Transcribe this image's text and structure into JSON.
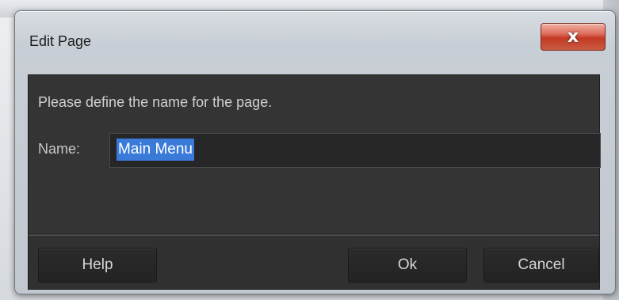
{
  "dialog": {
    "title": "Edit Page",
    "close_label": "x",
    "message": "Please define the name for the page.",
    "name_label": "Name:",
    "name_value": "Main Menu",
    "buttons": {
      "help": "Help",
      "ok": "Ok",
      "cancel": "Cancel"
    }
  },
  "colors": {
    "client_bg": "#343434",
    "input_bg": "#262626",
    "selection": "#3a7ad9",
    "close_button": "#c33a24"
  },
  "icons": {
    "close": "close-icon"
  }
}
